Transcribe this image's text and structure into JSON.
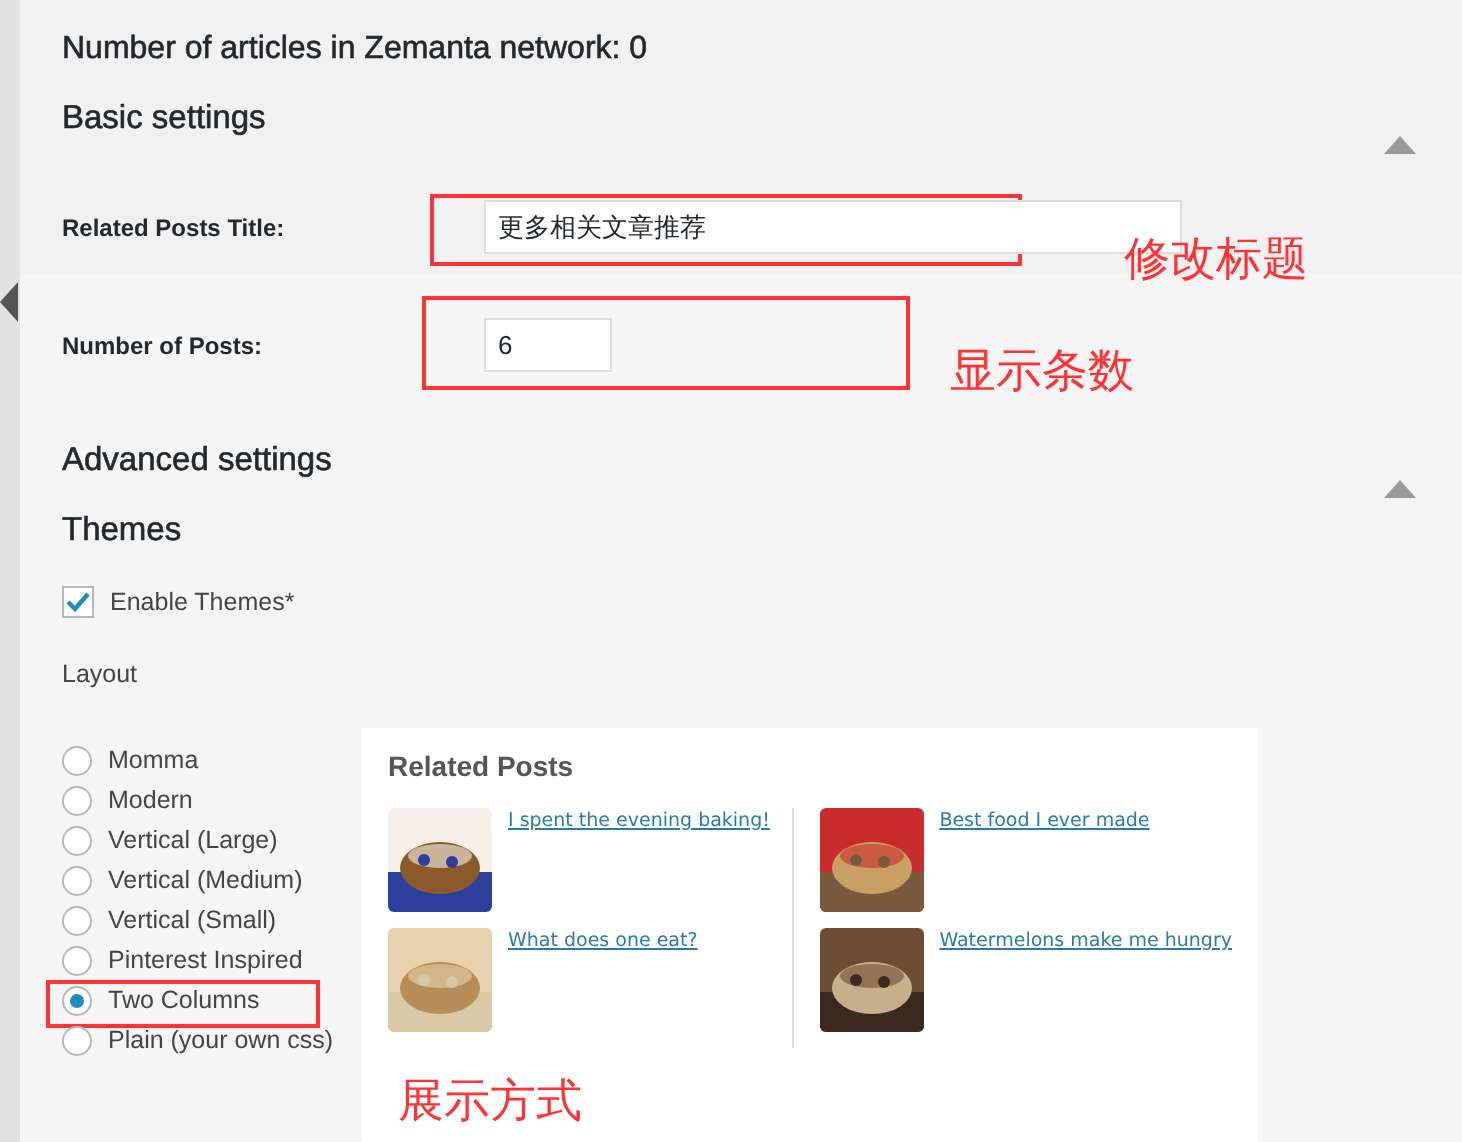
{
  "header": {
    "network_count": "Number of articles in Zemanta network: 0"
  },
  "basic_settings": {
    "title": "Basic settings",
    "expanded": true,
    "fields": [
      {
        "label": "Related Posts Title:",
        "value": "更多相关文章推荐",
        "kind": "wide"
      },
      {
        "label": "Number of Posts:",
        "value": "6",
        "kind": "narrow"
      }
    ]
  },
  "advanced_settings": {
    "title": "Advanced settings",
    "expanded": true
  },
  "themes": {
    "title": "Themes",
    "enable": {
      "label": "Enable Themes*",
      "checked": true
    },
    "layout_label": "Layout",
    "options": [
      {
        "label": "Momma",
        "selected": false
      },
      {
        "label": "Modern",
        "selected": false
      },
      {
        "label": "Vertical (Large)",
        "selected": false
      },
      {
        "label": "Vertical (Medium)",
        "selected": false
      },
      {
        "label": "Vertical (Small)",
        "selected": false
      },
      {
        "label": "Pinterest Inspired",
        "selected": false
      },
      {
        "label": "Two Columns",
        "selected": true
      },
      {
        "label": "Plain (your own css)",
        "selected": false
      }
    ]
  },
  "preview": {
    "title": "Related Posts",
    "columns": [
      [
        {
          "title": "I spent the evening baking!",
          "kind": "picture"
        },
        {
          "title": "What does one eat?",
          "kind": "picture"
        }
      ],
      [
        {
          "title": "Best food I ever made",
          "kind": "picture"
        },
        {
          "title": "Watermelons make me hungry",
          "kind": "picture"
        }
      ]
    ]
  },
  "annotations": [
    {
      "text": "修改标题"
    },
    {
      "text": "显示条数"
    },
    {
      "text": "展示方式"
    }
  ]
}
